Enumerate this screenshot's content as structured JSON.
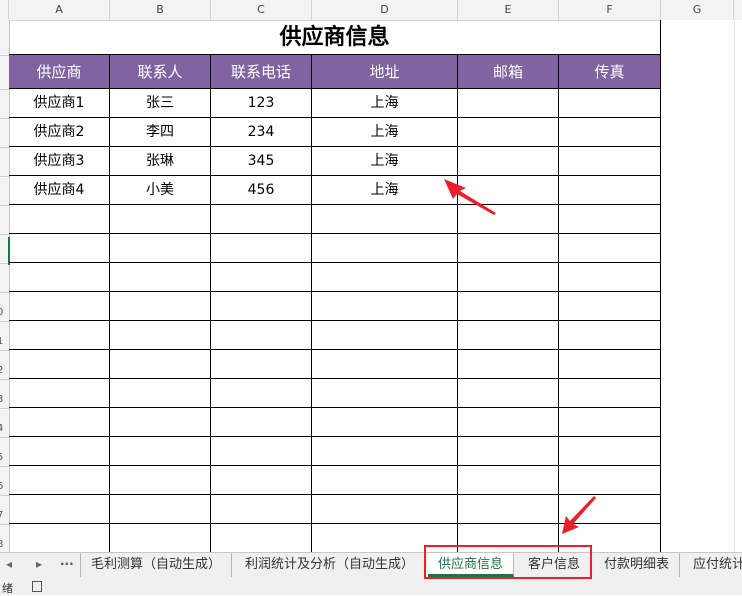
{
  "columns": [
    "A",
    "B",
    "C",
    "D",
    "E",
    "F",
    "G"
  ],
  "row_numbers": [
    "0",
    "1",
    "2",
    "3",
    "4",
    "5",
    "6",
    "7",
    "8"
  ],
  "sheet": {
    "title": "供应商信息",
    "headers": [
      "供应商",
      "联系人",
      "联系电话",
      "地址",
      "邮箱",
      "传真"
    ],
    "rows": [
      [
        "供应商1",
        "张三",
        "123",
        "上海",
        "",
        ""
      ],
      [
        "供应商2",
        "李四",
        "234",
        "上海",
        "",
        ""
      ],
      [
        "供应商3",
        "张琳",
        "345",
        "上海",
        "",
        ""
      ],
      [
        "供应商4",
        "小美",
        "456",
        "上海",
        "",
        ""
      ]
    ],
    "header_color": "#8064a2"
  },
  "tabs": {
    "more": "...",
    "items": [
      {
        "label": "毛利测算（自动生成）"
      },
      {
        "label": "利润统计及分析（自动生成）"
      },
      {
        "label": "供应商信息",
        "active": true
      },
      {
        "label": "客户信息"
      },
      {
        "label": "付款明细表"
      },
      {
        "label": "应付统计"
      }
    ]
  },
  "status": {
    "text": "绪"
  },
  "annotation_color": "#e8212a",
  "accent_color": "#217346"
}
